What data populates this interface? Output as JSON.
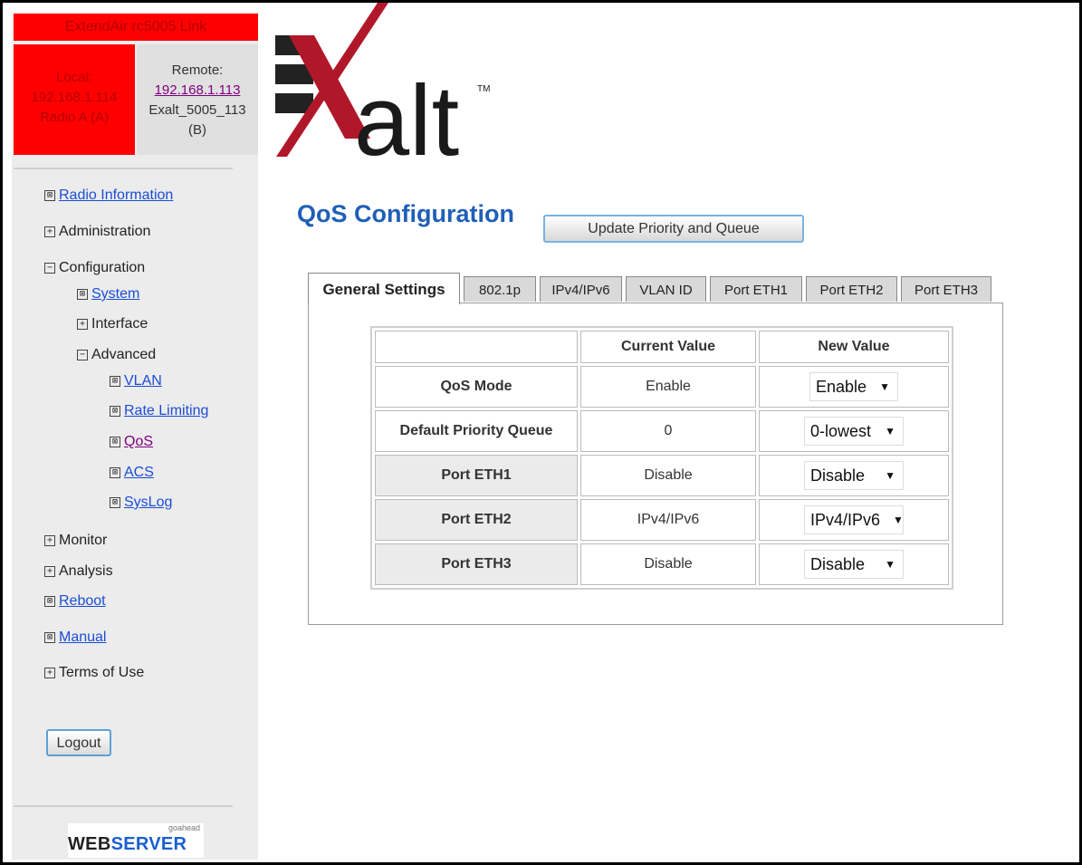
{
  "sidebar": {
    "link_title": "ExtendAir rc5005 Link",
    "local": {
      "label": "Local:",
      "ip": "192.168.1.114",
      "radio": "Radio A (A)"
    },
    "remote": {
      "label": "Remote:",
      "ip": "192.168.1.113",
      "name": "Exalt_5005_113",
      "radio": "(B)"
    },
    "nav": {
      "radio_information": "Radio Information",
      "administration": "Administration",
      "configuration": "Configuration",
      "system": "System",
      "interface": "Interface",
      "advanced": "Advanced",
      "vlan": "VLAN",
      "rate_limiting": "Rate Limiting",
      "qos": "QoS",
      "acs": "ACS",
      "syslog": "SysLog",
      "monitor": "Monitor",
      "analysis": "Analysis",
      "reboot": "Reboot",
      "manual": "Manual",
      "terms_of_use": "Terms of Use"
    },
    "logout_label": "Logout",
    "webserver": {
      "small": "goahead",
      "web": "WEB",
      "server": "SERVER"
    }
  },
  "logo": {
    "text": "alt",
    "tm": "TM"
  },
  "main": {
    "title": "QoS Configuration",
    "update_button": "Update Priority and Queue",
    "tabs": [
      "General Settings",
      "802.1p",
      "IPv4/IPv6",
      "VLAN ID",
      "Port ETH1",
      "Port ETH2",
      "Port ETH3"
    ],
    "table": {
      "headers": [
        "",
        "Current Value",
        "New Value"
      ],
      "rows": [
        {
          "label": "QoS Mode",
          "current": "Enable",
          "new": "Enable"
        },
        {
          "label": "Default Priority Queue",
          "current": "0",
          "new": "0-lowest"
        },
        {
          "label": "Port ETH1",
          "current": "Disable",
          "new": "Disable"
        },
        {
          "label": "Port ETH2",
          "current": "IPv4/IPv6",
          "new": "IPv4/IPv6"
        },
        {
          "label": "Port ETH3",
          "current": "Disable",
          "new": "Disable"
        }
      ]
    }
  },
  "colors": {
    "red_panel": "#ff0000",
    "title_blue": "#1f5fb8",
    "link_blue": "#1a4dd6",
    "visited": "#800080",
    "logo_red": "#b0182a"
  }
}
